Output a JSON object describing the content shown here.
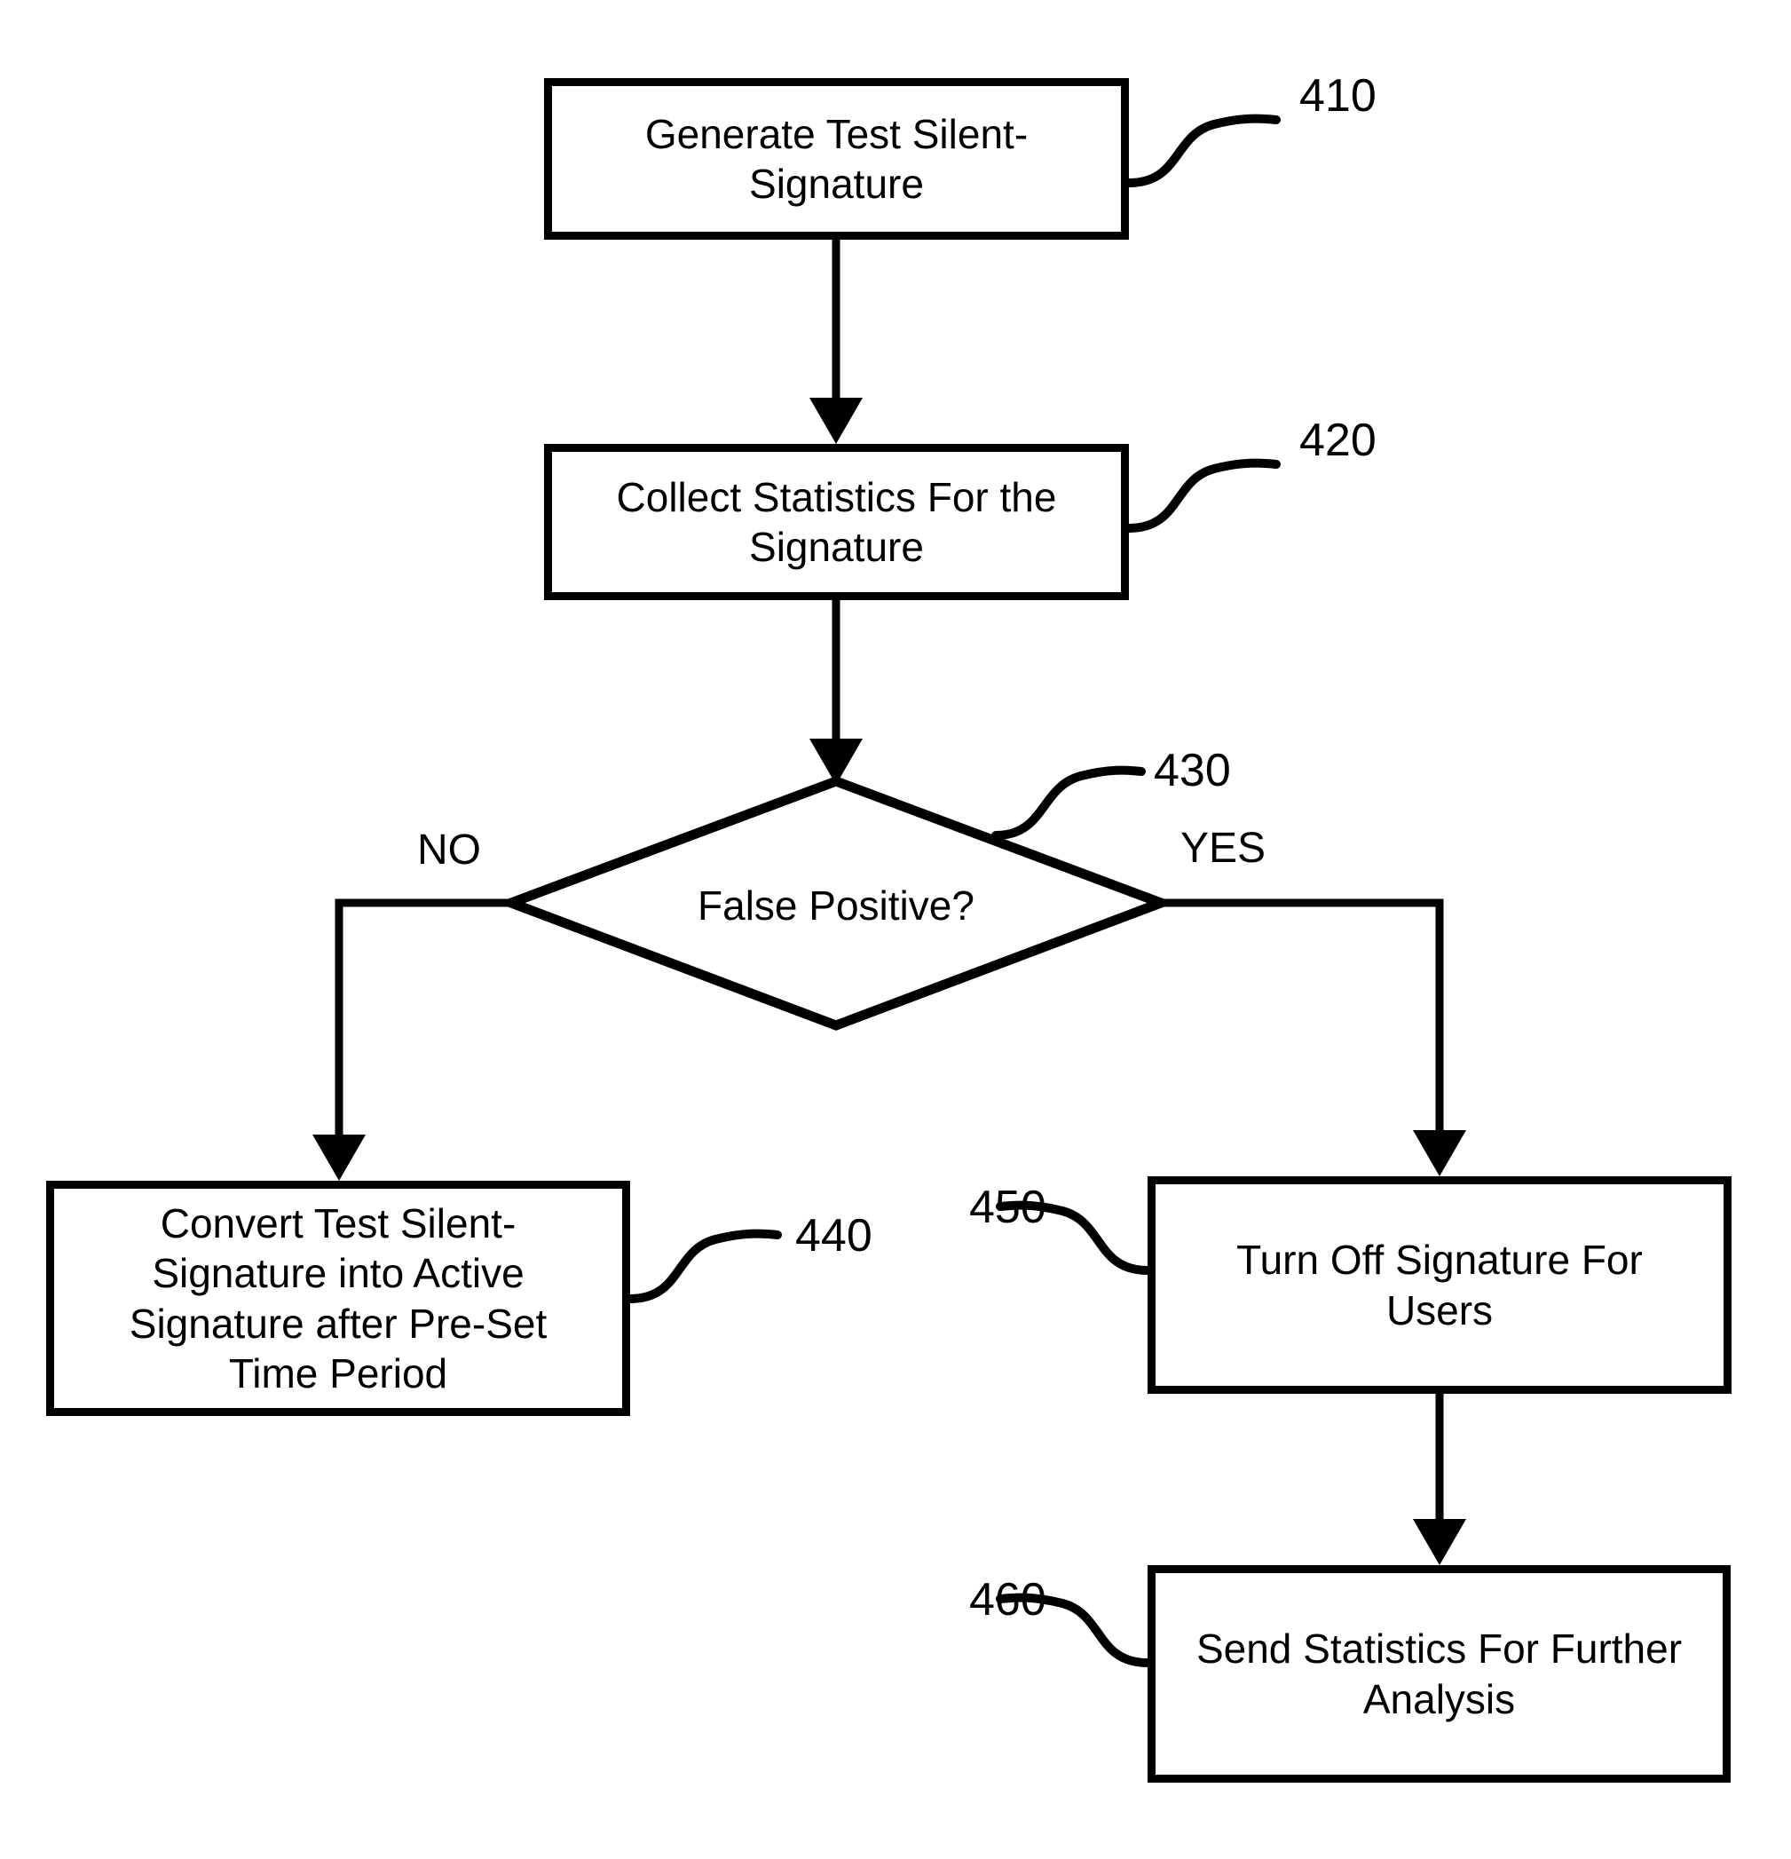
{
  "figure": {
    "type": "flowchart",
    "title": "Silent-Signature Testing Process Flowchart",
    "background_color": "#ffffff",
    "stroke_color": "#000000"
  },
  "nodes": [
    {
      "id": "n410",
      "shape": "process",
      "ref": "410",
      "text": "Generate Test Silent-\nSignature"
    },
    {
      "id": "n420",
      "shape": "process",
      "ref": "420",
      "text": "Collect Statistics For the\nSignature"
    },
    {
      "id": "n430",
      "shape": "decision",
      "ref": "430",
      "text": "False Positive?"
    },
    {
      "id": "n440",
      "shape": "process",
      "ref": "440",
      "text": "Convert Test Silent-\nSignature into  Active\nSignature after Pre-Set\nTime Period"
    },
    {
      "id": "n450",
      "shape": "process",
      "ref": "450",
      "text": "Turn Off Signature For\nUsers"
    },
    {
      "id": "n460",
      "shape": "process",
      "ref": "460",
      "text": "Send Statistics For Further\nAnalysis"
    }
  ],
  "branch_labels": {
    "no": "NO",
    "yes": "YES"
  },
  "ref_numbers": {
    "n410": "410",
    "n420": "420",
    "n430": "430",
    "n440": "440",
    "n450": "450",
    "n460": "460"
  }
}
